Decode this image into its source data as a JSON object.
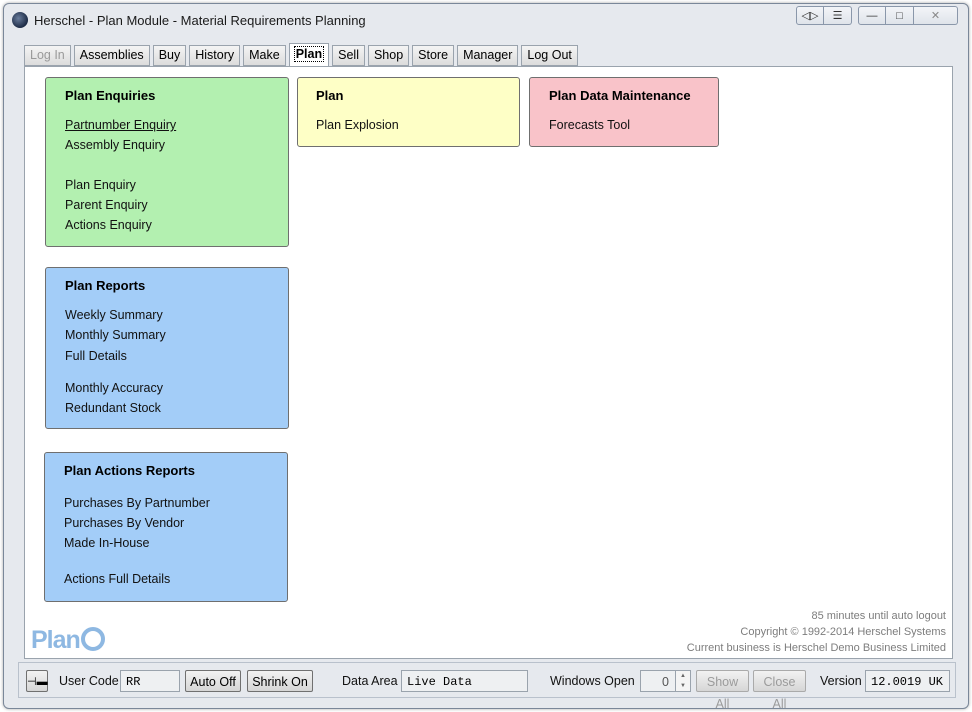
{
  "window": {
    "title": "Herschel - Plan Module - Material Requirements Planning",
    "icon": "herschel-app-icon",
    "controls": [
      "◁▷",
      "☰",
      "—",
      "□",
      "✕"
    ]
  },
  "tabs": [
    {
      "label": "Log In",
      "state": "disabled"
    },
    {
      "label": "Assemblies",
      "state": "normal"
    },
    {
      "label": "Buy",
      "state": "normal"
    },
    {
      "label": "History",
      "state": "normal"
    },
    {
      "label": "Make",
      "state": "normal"
    },
    {
      "label": "Plan",
      "state": "active"
    },
    {
      "label": "Sell",
      "state": "normal"
    },
    {
      "label": "Shop",
      "state": "normal"
    },
    {
      "label": "Store",
      "state": "normal"
    },
    {
      "label": "Manager",
      "state": "normal"
    },
    {
      "label": "Log Out",
      "state": "normal"
    }
  ],
  "cards": {
    "plan_enquiries": {
      "title": "Plan Enquiries",
      "items": [
        "Partnumber Enquiry",
        "Assembly Enquiry",
        "Plan Enquiry",
        "Parent Enquiry",
        "Actions Enquiry"
      ],
      "color": "#b3f0b0"
    },
    "plan": {
      "title": "Plan",
      "items": [
        "Plan Explosion"
      ],
      "color": "#feffc6"
    },
    "plan_data_maintenance": {
      "title": "Plan Data Maintenance",
      "items": [
        "Forecasts Tool"
      ],
      "color": "#f9c3c9"
    },
    "plan_reports": {
      "title": "Plan Reports",
      "items": [
        "Weekly Summary",
        "Monthly Summary",
        "Full Details",
        "Monthly Accuracy",
        "Redundant Stock"
      ],
      "color": "#a3cdf8"
    },
    "plan_actions_reports": {
      "title": "Plan Actions Reports",
      "items": [
        "Purchases By Partnumber",
        "Purchases By Vendor",
        "Made In-House",
        "Actions Full Details"
      ],
      "color": "#a3cdf8"
    }
  },
  "info": {
    "auto_logout": "85 minutes until auto logout",
    "copyright": "Copyright © 1992-2014 Herschel Systems",
    "business": "Current business is Herschel Demo Business Limited"
  },
  "logo": {
    "text": "Plan"
  },
  "statusbar": {
    "user_code_label": "User Code",
    "user_code_value": "RR",
    "auto_off": "Auto Off",
    "shrink_on": "Shrink On",
    "data_area_label": "Data Area",
    "data_area_value": "Live Data",
    "windows_open_label": "Windows Open",
    "windows_open_value": "0",
    "show_all": "Show All",
    "close_all": "Close All",
    "version_label": "Version",
    "version_value": "12.0019 UK"
  }
}
